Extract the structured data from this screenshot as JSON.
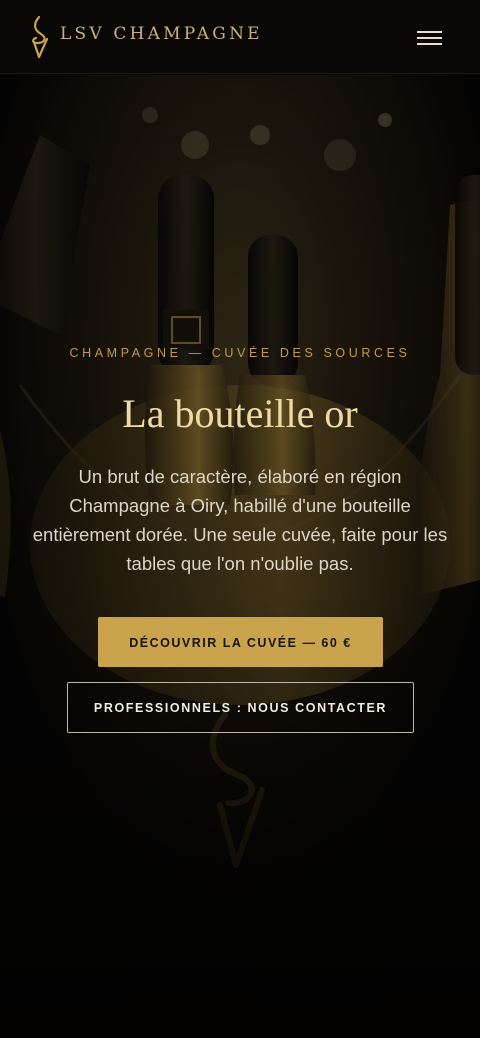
{
  "header": {
    "brand": "LSV CHAMPAGNE",
    "logo_icon": "lsv-monogram-icon",
    "menu_icon": "hamburger-menu-icon"
  },
  "hero": {
    "eyebrow": "CHAMPAGNE — CUVÉE DES SOURCES",
    "title": "La bouteille or",
    "description": "Un brut de caractère, élaboré en région Champagne à Oiry, habillé d'une bouteille entièrement dorée. Une seule cuvée, faite pour les tables que l'on n'oublie pas.",
    "cta_primary": "DÉCOUVRIR LA CUVÉE — 60 €",
    "cta_secondary": "PROFESSIONNELS : NOUS CONTACTER"
  },
  "colors": {
    "accent_gold": "#c9a44c",
    "title_gold": "#efdca4",
    "eyebrow_gold": "#c29a48",
    "background": "#060504"
  }
}
